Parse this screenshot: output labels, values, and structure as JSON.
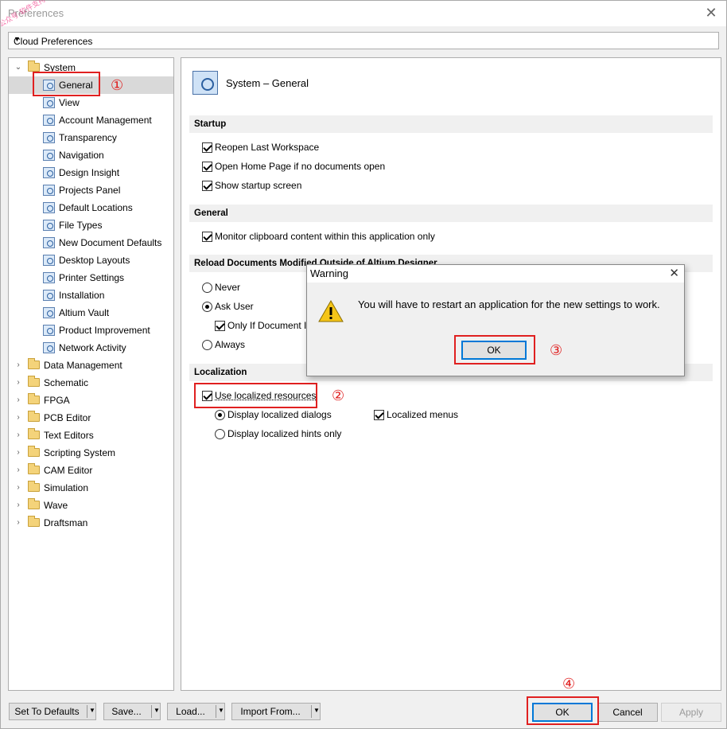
{
  "window": {
    "title": "Preferences",
    "close": "✕"
  },
  "watermark": "公众号·软件支持",
  "combo": {
    "value": "Cloud Preferences"
  },
  "tree": {
    "system": "System",
    "children": [
      "General",
      "View",
      "Account Management",
      "Transparency",
      "Navigation",
      "Design Insight",
      "Projects Panel",
      "Default Locations",
      "File Types",
      "New Document Defaults",
      "Desktop Layouts",
      "Printer Settings",
      "Installation",
      "Altium Vault",
      "Product Improvement",
      "Network Activity"
    ],
    "folders": [
      "Data Management",
      "Schematic",
      "FPGA",
      "PCB Editor",
      "Text Editors",
      "Scripting System",
      "CAM Editor",
      "Simulation",
      "Wave",
      "Draftsman"
    ]
  },
  "panel": {
    "title": "System – General",
    "startup": {
      "header": "Startup",
      "reopen": "Reopen Last Workspace",
      "homepage": "Open Home Page if no documents open",
      "splash": "Show startup screen"
    },
    "general": {
      "header": "General",
      "clipboard": "Monitor clipboard content within this application only"
    },
    "reload": {
      "header": "Reload Documents Modified Outside of Altium Designer",
      "never": "Never",
      "ask": "Ask User",
      "only_if": "Only If Document Is",
      "always": "Always"
    },
    "localization": {
      "header": "Localization",
      "use_localized": "Use localized resources",
      "dialogs": "Display localized dialogs",
      "hints": "Display localized hints only",
      "menus": "Localized menus"
    }
  },
  "dialog": {
    "title": "Warning",
    "close": "✕",
    "message": "You will have to restart an application for the new settings to work.",
    "ok": "OK"
  },
  "annotations": {
    "n1": "①",
    "n2": "②",
    "n3": "③",
    "n4": "④"
  },
  "footer": {
    "set_defaults": "Set To Defaults",
    "save": "Save...",
    "load": "Load...",
    "import": "Import From...",
    "ok": "OK",
    "cancel": "Cancel",
    "apply": "Apply"
  },
  "colors": {
    "annotation_red": "#e02020",
    "accent_blue": "#0078d7"
  }
}
